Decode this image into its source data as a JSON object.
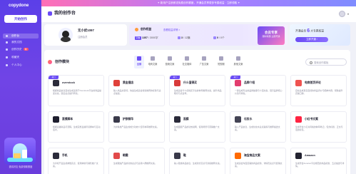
{
  "sidebar": {
    "logo": "copydone",
    "primary_button": "开始创作",
    "items": [
      {
        "label": "创作台",
        "active": true
      },
      {
        "label": "我的文档"
      },
      {
        "label": "创作历史",
        "badge": "新"
      },
      {
        "label": "收藏夹"
      },
      {
        "label": "个人中心"
      }
    ],
    "caption": "邀请好友 免费领取额度"
  },
  "topbar": {
    "announcement": "✦ 新用户注册即送免费创作额度，开通会员享更多专属权益 · 立即领取 ✦"
  },
  "header": {
    "title": "我的创作台",
    "avatar_caret": "▾"
  },
  "user": {
    "name": "无小优1097",
    "level": "注册会员"
  },
  "stats": {
    "title": "创作权益",
    "link": "查看权益详情 >",
    "words_tag": "字数",
    "words_value": "1357",
    "words_total": "/ 3000字",
    "projects_value": "3",
    "projects_total": "/ 12篇",
    "docs_value": "0",
    "docs_total": "/ 0个"
  },
  "promo": {
    "line1": "会员专享",
    "line2": "限时特惠 立即开通"
  },
  "vip": {
    "prefix": "开通会员",
    "count": "6",
    "suffix": "大专属权益",
    "button": "立即开通 ›"
  },
  "module": {
    "title": "创作模块",
    "tabs": [
      {
        "label": "全部",
        "active": true
      },
      {
        "label": "电商文案"
      },
      {
        "label": "营销文案"
      },
      {
        "label": "社交媒体"
      },
      {
        "label": "广告文案"
      },
      {
        "label": "短视频"
      },
      {
        "label": "其他文案"
      }
    ],
    "search_placeholder": "搜索创作模板"
  },
  "tools": [
    {
      "name": "overstock",
      "desc": "根据商品信息自动生成适用于Overstock平台的商品描述文案，突出卖点提升转化。",
      "tag": "热门",
      "icon_color": "#2b2b3a"
    },
    {
      "name": "黄金搜店",
      "desc": "输入商品关键词，快速生成适合搜索推荐的标题与卖点描述。",
      "tag": "",
      "icon_color": "#e0413a"
    },
    {
      "name": "什么值得买",
      "desc": "生成适合什么值得买平台的种草推荐文案，提升商品曝光与点击率。",
      "tag": "热门",
      "icon_color": "#d83b3b"
    },
    {
      "name": "品牌介绍",
      "desc": "一键生成专业的品牌故事与介绍文案，展示品牌核心价值与特色。",
      "tag": "热门",
      "icon_color": "#e23c6e"
    },
    {
      "name": "电商首页评论",
      "desc": "自动生成真实自然的商品评价与晒单内容，帮助提升店铺口碑。",
      "tag": "",
      "icon_color": "#ef5350"
    },
    {
      "name": "直播脚本",
      "desc": "根据直播商品与流程，生成完整直播带货脚本与互动话术。",
      "tag": "",
      "icon_color": "#1e1e2e"
    },
    {
      "name": "护肤精华",
      "desc": "为护肤类产品生成成分功效介绍与种草推荐文案。",
      "tag": "",
      "icon_color": "#3a3a4a"
    },
    {
      "name": "面膜",
      "desc": "生成面膜产品的功效说明、使用场景与营销推广文案。",
      "tag": "",
      "icon_color": "#2b2b3a"
    },
    {
      "name": "化妆水",
      "desc": "输入产品信息，生成化妆水卖点提炼与推荐描述文案。",
      "tag": "",
      "icon_color": "#444455"
    },
    {
      "name": "小红书文案",
      "desc": "生成符合小红书风格的种草笔记，包含标题、正文与话题标签。",
      "tag": "",
      "icon_color": "#ff2442"
    },
    {
      "name": "手机",
      "desc": "为手机产品生成参数亮点、使用体验与销售推广文案。",
      "tag": "",
      "icon_color": "#2b2b3a"
    },
    {
      "name": "眼霜",
      "desc": "生成眼霜产品的功效卖点与适用人群推荐文案。",
      "tag": "",
      "icon_color": "#e24a4a"
    },
    {
      "name": "鞋",
      "desc": "输入鞋类商品信息，生成款式亮点与穿搭推荐文案。",
      "tag": "",
      "icon_color": "#3a3a4a"
    },
    {
      "name": "淘宝商品文案",
      "desc": "生成适合淘宝店铺的商品标题、详情页卖点与促销文案。",
      "tag": "",
      "icon_color": "#ff6a00"
    },
    {
      "name": "Amazon",
      "desc": "生成符合Amazon平台规范的商品标题、五点描述与详情。",
      "tag": "",
      "icon_color": "#222230"
    }
  ]
}
